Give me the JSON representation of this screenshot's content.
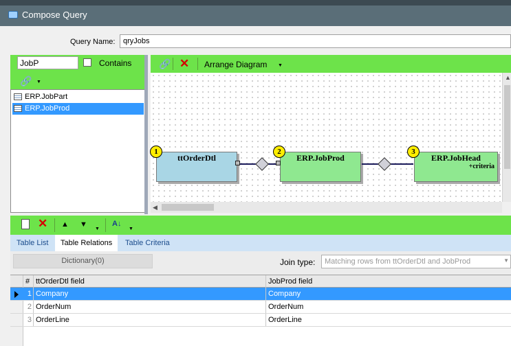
{
  "window": {
    "title": "Compose Query"
  },
  "query": {
    "name_label": "Query Name:",
    "name_value": "qryJobs"
  },
  "left_panel": {
    "search_value": "JobP",
    "contains_label": "Contains",
    "tables": [
      "ERP.JobPart",
      "ERP.JobProd"
    ]
  },
  "diagram_toolbar": {
    "arrange_label": "Arrange Diagram"
  },
  "diagram": {
    "nodes": [
      {
        "index": "1",
        "title": "ttOrderDtl",
        "sub": ""
      },
      {
        "index": "2",
        "title": "ERP.JobProd",
        "sub": ""
      },
      {
        "index": "3",
        "title": "ERP.JobHead",
        "sub": "+criteria"
      }
    ]
  },
  "tabs": [
    "Table List",
    "Table Relations",
    "Table Criteria"
  ],
  "relations": {
    "dictionary_label": "Dictionary(0)",
    "join_type_label": "Join type:",
    "join_type_value": "Matching rows from ttOrderDtl and JobProd"
  },
  "grid": {
    "headers": [
      "#",
      "ttOrderDtl field",
      "JobProd field"
    ],
    "rows": [
      {
        "num": "1",
        "left": "Company",
        "right": "Company"
      },
      {
        "num": "2",
        "left": "OrderNum",
        "right": "OrderNum"
      },
      {
        "num": "3",
        "left": "OrderLine",
        "right": "OrderLine"
      }
    ]
  },
  "colors": {
    "toolbar_green": "#6de34a",
    "selection_blue": "#3399ff",
    "node_blue": "#a9d6e5",
    "node_green": "#8fe890",
    "badge_yellow": "#ffee00"
  }
}
